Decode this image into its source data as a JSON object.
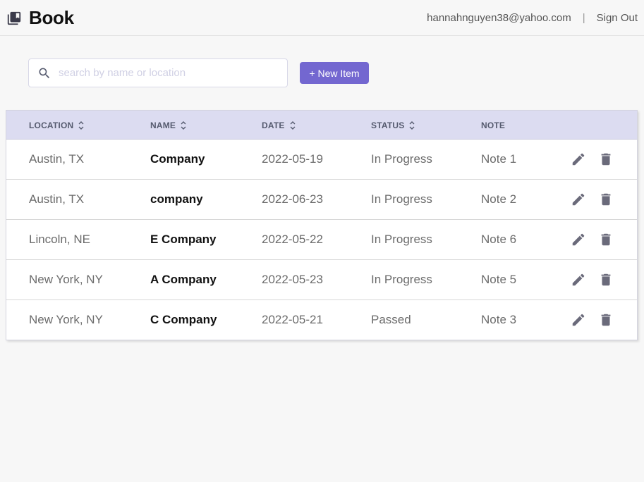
{
  "header": {
    "title": "Book",
    "user_email": "hannahnguyen38@yahoo.com",
    "separator": "|",
    "signout_label": "Sign Out",
    "logo_icon": "book-library-icon"
  },
  "toolbar": {
    "search_placeholder": "search by name or location",
    "search_value": "",
    "new_item_label": "+ New Item",
    "accent_color": "#7367d0"
  },
  "table": {
    "columns": {
      "location": "LOCATION",
      "name": "NAME",
      "date": "DATE",
      "status": "STATUS",
      "note": "NOTE"
    },
    "rows": [
      {
        "location": "Austin, TX",
        "name": "Company",
        "date": "2022-05-19",
        "status": "In Progress",
        "note": "Note 1"
      },
      {
        "location": "Austin, TX",
        "name": "company",
        "date": "2022-06-23",
        "status": "In Progress",
        "note": "Note 2"
      },
      {
        "location": "Lincoln, NE",
        "name": "E Company",
        "date": "2022-05-22",
        "status": "In Progress",
        "note": "Note 6"
      },
      {
        "location": "New York, NY",
        "name": "A Company",
        "date": "2022-05-23",
        "status": "In Progress",
        "note": "Note 5"
      },
      {
        "location": "New York, NY",
        "name": "C Company",
        "date": "2022-05-21",
        "status": "Passed",
        "note": "Note 3"
      }
    ],
    "header_bg": "#dcdcf1",
    "row_actions": [
      "pencil-icon",
      "trash-icon"
    ]
  }
}
